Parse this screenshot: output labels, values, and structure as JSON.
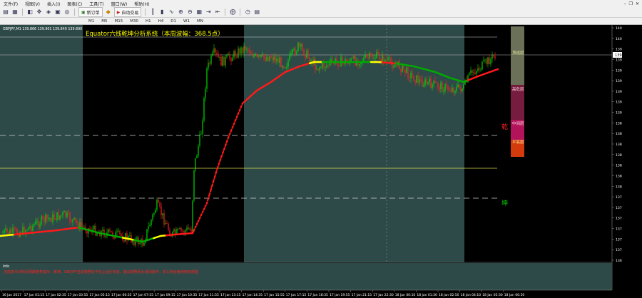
{
  "menu": {
    "items": [
      "文件(F)",
      "视图(V)",
      "插入(I)",
      "图表(C)",
      "工具(T)",
      "窗口(W)",
      "帮助(H)"
    ]
  },
  "toolbar": {
    "new_order_label": "新订单",
    "auto_trade_label": "自动交易",
    "timeframes": [
      "M1",
      "M5",
      "M15",
      "M30",
      "H1",
      "H4",
      "D1",
      "W1",
      "MN"
    ],
    "active_timeframe": "M1"
  },
  "chart": {
    "header": "GBPJPY,M1  139.866 139.901 139.849 139.890",
    "indicator_title": "Equator六线乾坤分析系统（本周波幅：368.5点）",
    "price_labels": [
      "140.280",
      "140.105",
      "139.955",
      "139.890",
      "139.805",
      "139.655",
      "139.505",
      "139.355",
      "139.205",
      "139.055",
      "138.905",
      "138.755",
      "138.605",
      "138.455",
      "138.305",
      "138.155",
      "138.005",
      "137.855",
      "137.705",
      "137.555",
      "137.405",
      "137.255",
      "137.105",
      "136.955"
    ],
    "current_price": "139.890",
    "zone_labels": {
      "top": "顶逃层",
      "high": "高危层",
      "mid": "中间层",
      "low": "平底层"
    },
    "qian_label": "乾",
    "kun_label": "坤",
    "time_labels": [
      "16 Jan 2017",
      "17 Jan 01:15",
      "17 Jan 02:35",
      "17 Jan 03:55",
      "17 Jan 05:15",
      "17 Jan 06:35",
      "17 Jan 07:55",
      "17 Jan 09:15",
      "17 Jan 10:35",
      "17 Jan 11:55",
      "17 Jan 13:15",
      "17 Jan 14:35",
      "17 Jan 15:55",
      "17 Jan 17:15",
      "17 Jan 18:35",
      "17 Jan 19:55",
      "17 Jan 21:15",
      "17 Jan 22:30",
      "18 Jan 00:10",
      "18 Jan 01:30",
      "18 Jan 02:50",
      "18 Jan 04:10",
      "18 Jan 05:30",
      "18 Jan 06:50"
    ],
    "sub_panel_label": "Info",
    "info_text": "当前货币对时间周期走势提示：乾坤，GBPJPY当前趋势处于向上运行状态，建议顺势而为进场操作，多头持仓继续持有观望"
  },
  "colors": {
    "panel_bg": "#2e4a48",
    "candle_up": "#00dd00",
    "candle_down": "#ff2020",
    "ma_red": "#ff1a1a",
    "ma_green": "#00aa00",
    "ma_yellow": "#ffff00",
    "title_yellow": "#ffff00",
    "info_red": "#ff2020"
  }
}
